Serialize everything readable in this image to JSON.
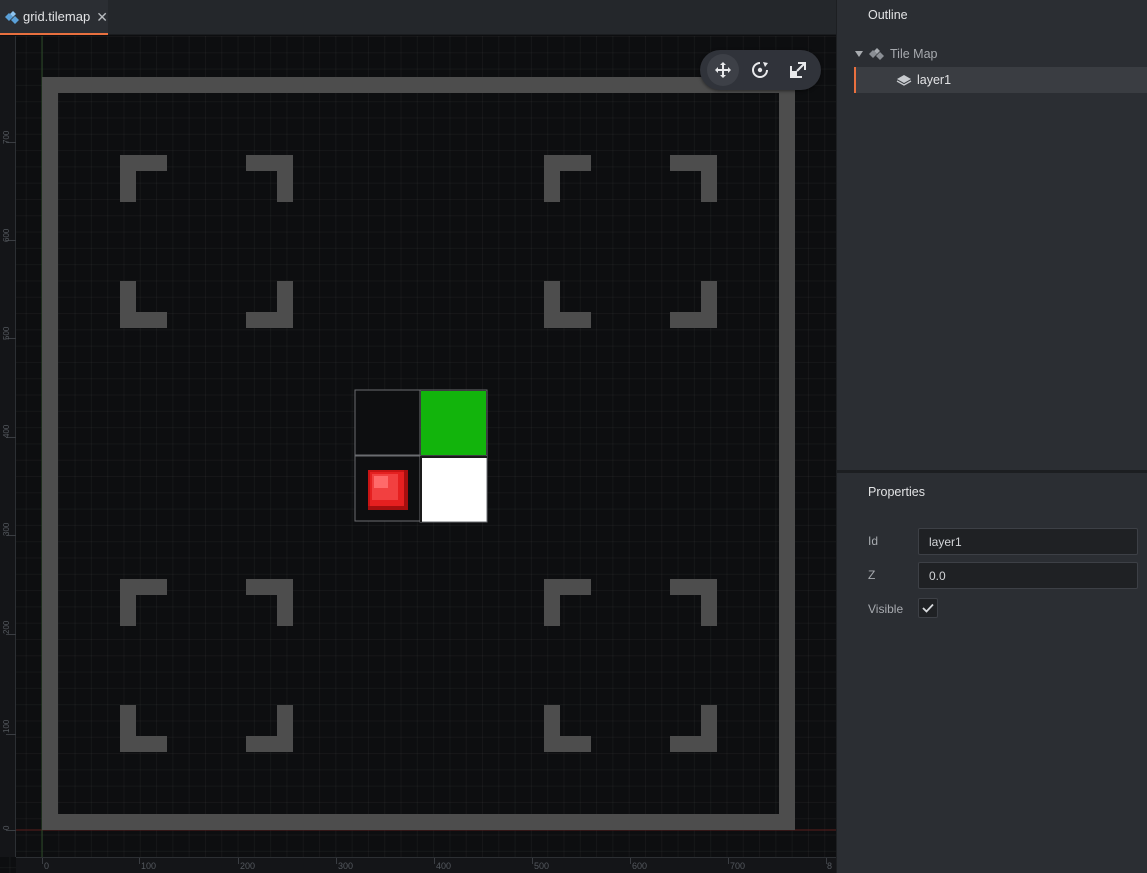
{
  "tab": {
    "label": "grid.tilemap",
    "close_glyph": "✕",
    "icon": "tilemap-icon"
  },
  "toolbar": {
    "tools": [
      {
        "name": "move-tool-icon",
        "active": true
      },
      {
        "name": "rotate-tool-icon",
        "active": false
      },
      {
        "name": "scale-tool-icon",
        "active": false
      }
    ]
  },
  "rulers": {
    "vertical": [
      "0",
      "100",
      "200",
      "300",
      "400",
      "500",
      "600",
      "700"
    ],
    "horizontal": [
      "0",
      "100",
      "200",
      "300",
      "400",
      "500",
      "600",
      "700",
      "8"
    ]
  },
  "tilemap": {
    "border_color": "#4d4d4d",
    "tile_colors": {
      "green": "#12b40c",
      "white": "#ffffff",
      "red": "#e52020"
    }
  },
  "outline": {
    "title": "Outline",
    "root": {
      "label": "Tile Map",
      "icon": "tilemap-icon"
    },
    "children": [
      {
        "label": "layer1",
        "icon": "layer-icon",
        "selected": true
      }
    ]
  },
  "properties": {
    "title": "Properties",
    "id_label": "Id",
    "id_value": "layer1",
    "z_label": "Z",
    "z_value": "0.0",
    "visible_label": "Visible",
    "visible_checked": true
  },
  "colors": {
    "accent": "#e9703f",
    "panel_bg": "#2b2e33",
    "viewport_bg": "#0d0e10"
  }
}
